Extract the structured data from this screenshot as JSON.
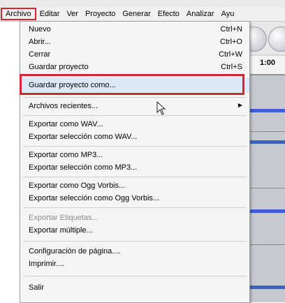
{
  "menubar": {
    "items": [
      {
        "label": "Archivo"
      },
      {
        "label": "Editar"
      },
      {
        "label": "Ver"
      },
      {
        "label": "Proyecto"
      },
      {
        "label": "Generar"
      },
      {
        "label": "Efecto"
      },
      {
        "label": "Analizar"
      },
      {
        "label": "Ayu"
      }
    ]
  },
  "file_menu": {
    "items": [
      {
        "label": "Nuevo",
        "shortcut": "Ctrl+N"
      },
      {
        "label": "Abrir...",
        "shortcut": "Ctrl+O"
      },
      {
        "label": "Cerrar",
        "shortcut": "Ctrl+W"
      },
      {
        "label": "Guardar proyecto",
        "shortcut": "Ctrl+S"
      },
      {
        "label": "Guardar proyecto como..."
      },
      {
        "label": "Archivos recientes..."
      },
      {
        "label": "Exportar como WAV..."
      },
      {
        "label": "Exportar selección como WAV..."
      },
      {
        "label": "Exportar como MP3..."
      },
      {
        "label": "Exportar selección como MP3..."
      },
      {
        "label": "Exportar como Ogg Vorbis..."
      },
      {
        "label": "Exportar selección como Ogg Vorbis..."
      },
      {
        "label": "Exportar Etiquetas..."
      },
      {
        "label": "Exportar múltiple..."
      },
      {
        "label": "Configuración de página...."
      },
      {
        "label": "Imprimir...."
      },
      {
        "label": "Salir"
      }
    ]
  },
  "background": {
    "ruler_label": "1:00"
  },
  "colors": {
    "highlight_border": "#d7262b",
    "waveform": "#3d5fd0"
  }
}
